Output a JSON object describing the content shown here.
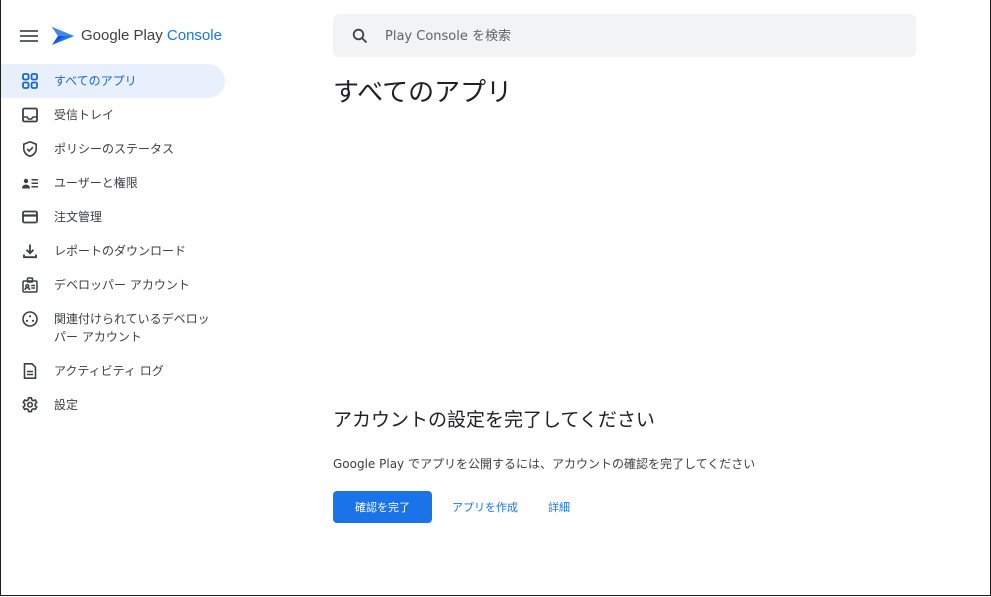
{
  "brand": {
    "name_prefix": "Google Play ",
    "name_accent": "Console",
    "accent_color": "#1a73e8"
  },
  "sidebar": {
    "items": [
      {
        "label": "すべてのアプリ",
        "icon": "apps-grid-icon",
        "active": true
      },
      {
        "label": "受信トレイ",
        "icon": "inbox-icon",
        "active": false
      },
      {
        "label": "ポリシーのステータス",
        "icon": "shield-check-icon",
        "active": false
      },
      {
        "label": "ユーザーと権限",
        "icon": "users-permissions-icon",
        "active": false
      },
      {
        "label": "注文管理",
        "icon": "credit-card-icon",
        "active": false
      },
      {
        "label": "レポートのダウンロード",
        "icon": "download-icon",
        "active": false
      },
      {
        "label": "デベロッパー アカウント",
        "icon": "developer-badge-icon",
        "active": false
      },
      {
        "label": "関連付けられているデベロッパー アカウント",
        "icon": "linked-accounts-icon",
        "active": false
      },
      {
        "label": "アクティビティ ログ",
        "icon": "document-log-icon",
        "active": false
      },
      {
        "label": "設定",
        "icon": "gear-icon",
        "active": false
      }
    ]
  },
  "search": {
    "placeholder": "Play Console を検索",
    "value": ""
  },
  "main": {
    "title": "すべてのアプリ",
    "setup": {
      "title": "アカウントの設定を完了してください",
      "description": "Google Play でアプリを公開するには、アカウントの確認を完了してください",
      "primary_button": "確認を完了",
      "create_app_link": "アプリを作成",
      "details_link": "詳細"
    }
  },
  "colors": {
    "active_nav_bg": "#e8f0fe",
    "active_nav_text": "#1967d2",
    "primary_button_bg": "#1a73e8",
    "search_bg": "#f1f3f4"
  }
}
